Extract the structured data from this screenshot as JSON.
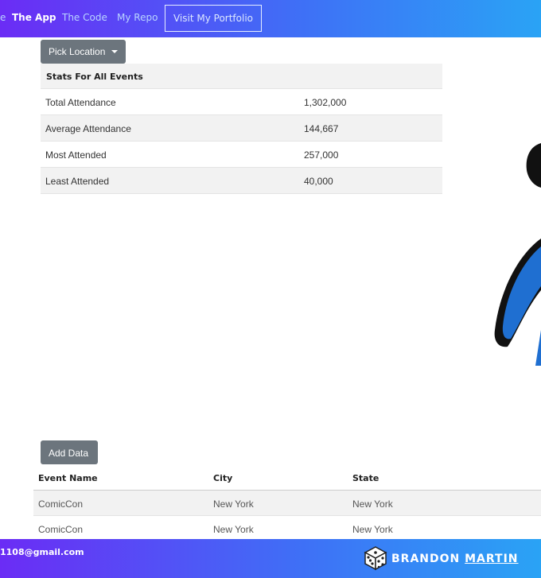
{
  "navbar": {
    "links": [
      {
        "label": "e"
      },
      {
        "label": "The App"
      },
      {
        "label": "The Code"
      },
      {
        "label": "My Repo"
      }
    ],
    "portfolio_label": "Visit My Portfolio"
  },
  "controls": {
    "pick_location_label": "Pick Location",
    "add_data_label": "Add Data"
  },
  "stats": {
    "header": "Stats For All Events",
    "rows": [
      {
        "label": "Total Attendance",
        "value": "1,302,000"
      },
      {
        "label": "Average Attendance",
        "value": "144,667"
      },
      {
        "label": "Most Attended",
        "value": "257,000"
      },
      {
        "label": "Least Attended",
        "value": "40,000"
      }
    ]
  },
  "events": {
    "columns": [
      "Event Name",
      "City",
      "State"
    ],
    "rows": [
      {
        "event": "ComicCon",
        "city": "New York",
        "state": "New York"
      },
      {
        "event": "ComicCon",
        "city": "New York",
        "state": "New York"
      }
    ]
  },
  "footer": {
    "email": "1108@gmail.com",
    "brand_first": "BRANDON",
    "brand_last": "MARTIN"
  },
  "colors": {
    "nav_gradient_start": "#6b2cf5",
    "nav_gradient_end": "#2aa3f5",
    "button_gray": "#6c757d",
    "table_stripe": "#f2f2f2",
    "graphic_blue": "#1f6fd1"
  }
}
